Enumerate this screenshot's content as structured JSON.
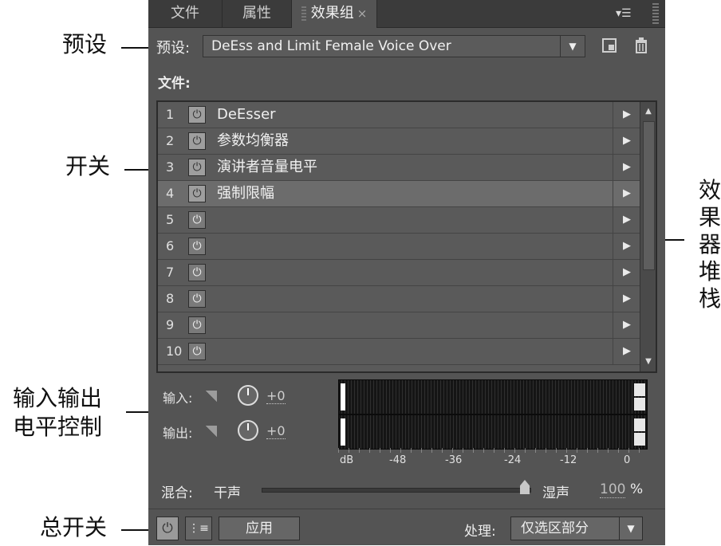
{
  "annotations": {
    "preset": "预设",
    "switch": "开关",
    "stack_chars": [
      "效",
      "果",
      "器",
      "堆",
      "栈"
    ],
    "io_line1": "输入输出",
    "io_line2": "电平控制",
    "master": "总开关"
  },
  "tabs": [
    {
      "label": "文件"
    },
    {
      "label": "属性"
    },
    {
      "label": "效果组",
      "close": "×"
    }
  ],
  "tab_menu_icon": "menu-icon",
  "preset": {
    "label": "预设:",
    "value": "DeEss and Limit Female Voice Over",
    "save_icon": "save-preset-icon",
    "delete_icon": "trash-icon"
  },
  "file_label": "文件:",
  "effects": [
    {
      "num": "1",
      "name": "DeEsser",
      "on": true
    },
    {
      "num": "2",
      "name": "参数均衡器",
      "on": true
    },
    {
      "num": "3",
      "name": "演讲者音量电平",
      "on": true
    },
    {
      "num": "4",
      "name": "强制限幅",
      "on": true,
      "selected": true
    },
    {
      "num": "5",
      "name": "",
      "on": false
    },
    {
      "num": "6",
      "name": "",
      "on": false
    },
    {
      "num": "7",
      "name": "",
      "on": false
    },
    {
      "num": "8",
      "name": "",
      "on": false
    },
    {
      "num": "9",
      "name": "",
      "on": false
    },
    {
      "num": "10",
      "name": "",
      "on": false
    }
  ],
  "io": {
    "input_label": "输入:",
    "input_value": "+0",
    "output_label": "输出:",
    "output_value": "+0",
    "scale": [
      "dB",
      "-48",
      "-36",
      "-24",
      "-12",
      "0"
    ]
  },
  "mix": {
    "label": "混合:",
    "dry": "干声",
    "wet": "湿声",
    "value": "100",
    "unit": "%",
    "level": 1.0
  },
  "bottom": {
    "apply": "应用",
    "process_label": "处理:",
    "process_value": "仅选区部分"
  },
  "colors": {
    "panel": "#545454",
    "tabbar": "#3b3b3b",
    "meter": "#151515"
  }
}
